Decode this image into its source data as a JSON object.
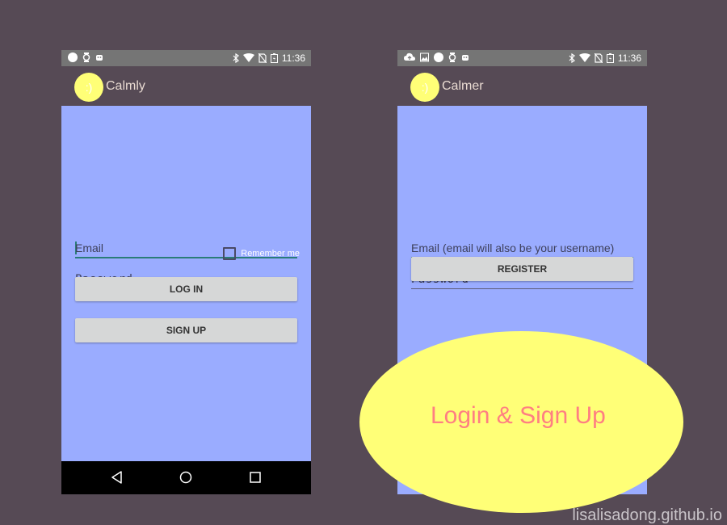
{
  "login_screen": {
    "status_bar": {
      "time": "11:36"
    },
    "app_bar": {
      "logo": ":)",
      "title": "Calmly"
    },
    "email_field": {
      "placeholder": "Email"
    },
    "password_field": {
      "placeholder": "Password"
    },
    "remember_label": "Remember me",
    "login_button": "LOG IN",
    "signup_button": "SIGN UP"
  },
  "register_screen": {
    "status_bar": {
      "time": "11:36"
    },
    "app_bar": {
      "logo": ":)",
      "title": "Calmer"
    },
    "email_field": {
      "placeholder": "Email (email will also be your username)"
    },
    "password_field": {
      "placeholder": "Password"
    },
    "register_button": "REGISTER"
  },
  "overlay": {
    "label": "Login & Sign Up"
  },
  "watermark": "lisalisadong.github.io",
  "colors": {
    "background": "#564a55",
    "content": "#9aacff",
    "accent_yellow": "#ffff77",
    "label_pink": "#ff7f82"
  }
}
